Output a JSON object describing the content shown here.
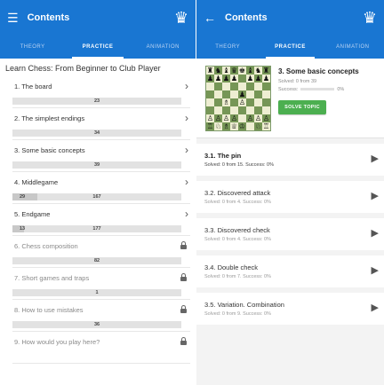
{
  "left": {
    "appbar": {
      "title": "Contents",
      "menu_icon": "menu-icon",
      "logo_icon": "chess-logo-icon"
    },
    "tabs": [
      {
        "label": "THEORY",
        "active": false
      },
      {
        "label": "PRACTICE",
        "active": true
      },
      {
        "label": "ANIMATION",
        "active": false
      }
    ],
    "course_title": "Learn Chess: From Beginner to Club Player",
    "chapters": [
      {
        "label": "1. The board",
        "trail": "›",
        "solved": "",
        "total": "23"
      },
      {
        "label": "2. The simplest endings",
        "trail": "›",
        "solved": "",
        "total": "34"
      },
      {
        "label": "3. Some basic concepts",
        "trail": "›",
        "solved": "",
        "total": "39"
      },
      {
        "label": "4. Middlegame",
        "trail": "›",
        "solved": "29",
        "total": "167"
      },
      {
        "label": "5. Endgame",
        "trail": "›",
        "solved": "13",
        "total": "177"
      },
      {
        "label": "6. Chess composition",
        "trail": "lock",
        "solved": "",
        "total": "82"
      },
      {
        "label": "7. Short games and traps",
        "trail": "lock",
        "solved": "",
        "total": "1"
      },
      {
        "label": "8. How to use mistakes",
        "trail": "lock",
        "solved": "",
        "total": "36"
      },
      {
        "label": "9. How would you play here?",
        "trail": "lock",
        "solved": "",
        "total": ""
      }
    ]
  },
  "right": {
    "appbar": {
      "title": "Contents",
      "back_icon": "back-arrow-icon",
      "logo_icon": "chess-logo-icon"
    },
    "tabs": [
      {
        "label": "THEORY",
        "active": false
      },
      {
        "label": "PRACTICE",
        "active": true
      },
      {
        "label": "ANIMATION",
        "active": false
      }
    ],
    "topic": {
      "title": "3. Some basic concepts",
      "solved_text": "Solved: 0 from 39",
      "success_label": "Success:",
      "success_value": "0%",
      "button_label": "SOLVE TOPIC"
    },
    "board": [
      "rnbqkbnr",
      "pppp.ppp",
      "........",
      "....p...",
      "..B.P...",
      "........",
      "PPPP.PPP",
      "RNBQK.NR"
    ],
    "subtopics": [
      {
        "title": "3.1. The pin",
        "stats": "Solved: 0 from 15. Success: 0%"
      },
      {
        "title": "3.2. Discovered attack",
        "stats": "Solved: 0 from 4. Success: 0%"
      },
      {
        "title": "3.3. Discovered check",
        "stats": "Solved: 0 from 4. Success: 0%"
      },
      {
        "title": "3.4. Double check",
        "stats": "Solved: 0 from 7. Success: 0%"
      },
      {
        "title": "3.5. Variation. Combination",
        "stats": "Solved: 0 from 9. Success: 0%"
      }
    ]
  },
  "colors": {
    "primary": "#1976d2",
    "accent_green": "#4caf50",
    "board_light": "#eeeed2",
    "board_dark": "#769656"
  }
}
